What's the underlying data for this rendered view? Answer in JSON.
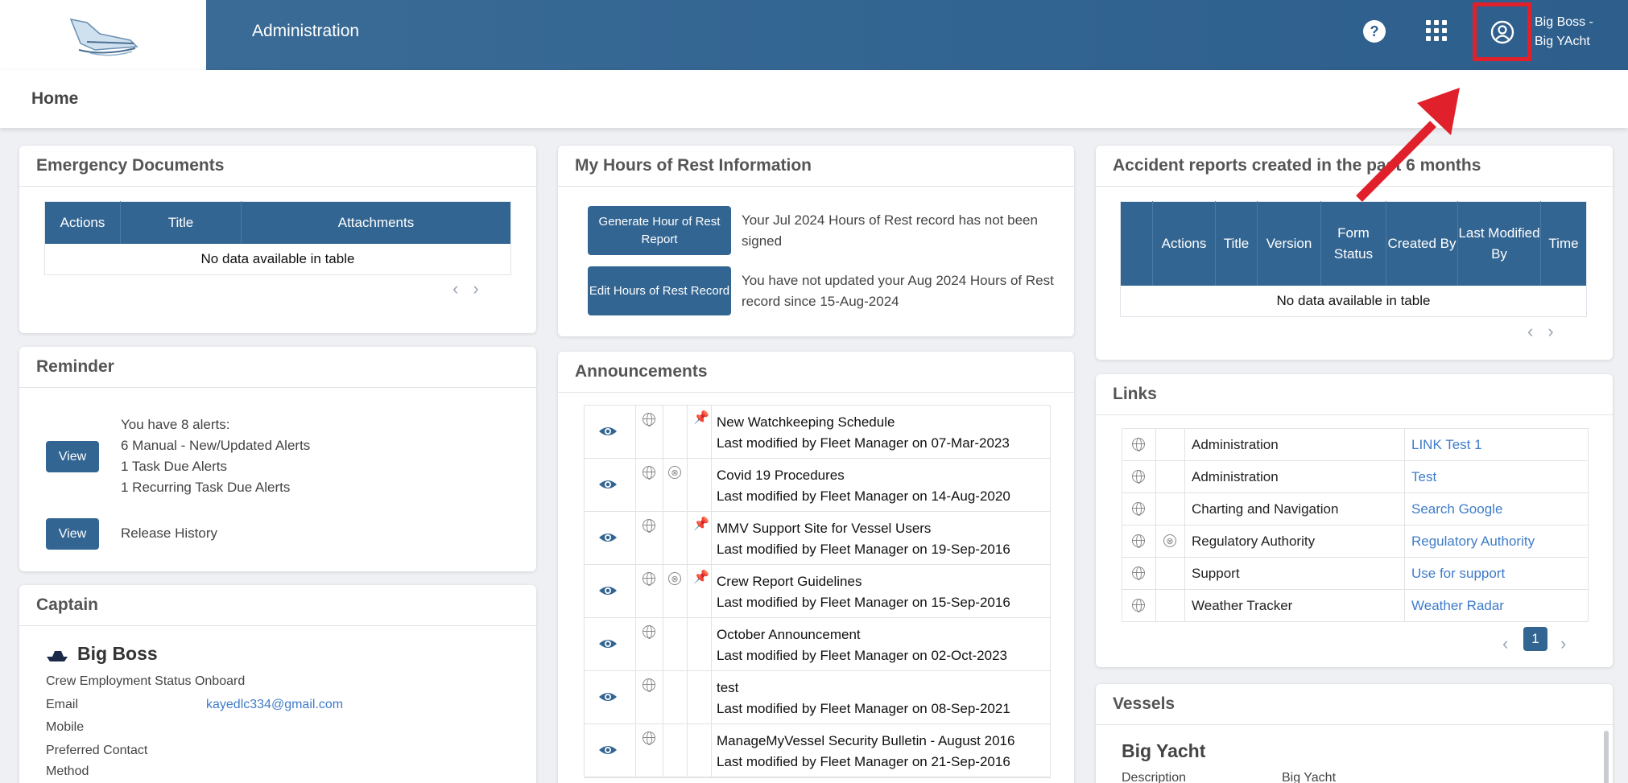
{
  "header": {
    "app_title": "Administration",
    "help_label": "?",
    "user_name_line1": "Big Boss -",
    "user_name_line2": "Big YAcht",
    "highlight_color": "#e0202a",
    "brand_color": "#336592"
  },
  "breadcrumb": {
    "current": "Home"
  },
  "emergency_documents": {
    "title": "Emergency Documents",
    "columns": [
      "Actions",
      "Title",
      "Attachments"
    ],
    "empty_text": "No data available in table",
    "pager": [
      "‹",
      "›"
    ]
  },
  "hours_of_rest": {
    "title": "My Hours of Rest Information",
    "generate_button": "Generate Hour of Rest Report",
    "generate_message": "Your Jul 2024 Hours of Rest record has not been signed",
    "edit_button": "Edit Hours of Rest Record",
    "edit_message": "You have not updated your Aug 2024 Hours of Rest record since 15-Aug-2024"
  },
  "accident_reports": {
    "title": "Accident reports created in the past 6 months",
    "columns": [
      "",
      "Actions",
      "Title",
      "Version",
      "Form Status",
      "Created By",
      "Last Modified By",
      "Time"
    ],
    "empty_text": "No data available in table",
    "pager": [
      "‹",
      "›"
    ]
  },
  "reminder": {
    "title": "Reminder",
    "view_label": "View",
    "alerts_lines": [
      "You have 8 alerts:",
      "6 Manual - New/Updated Alerts",
      "1 Task Due Alerts",
      "1 Recurring Task Due Alerts"
    ],
    "release_view_label": "View",
    "release_text": "Release History"
  },
  "announcements": {
    "title": "Announcements",
    "items": [
      {
        "title": "New Watchkeeping Schedule",
        "modified": "Last modified by Fleet Manager on 07-Mar-2023",
        "reg": false,
        "pin": true
      },
      {
        "title": "Covid 19 Procedures",
        "modified": "Last modified by Fleet Manager on 14-Aug-2020",
        "reg": true,
        "pin": false
      },
      {
        "title": "MMV Support Site for Vessel Users",
        "modified": "Last modified by Fleet Manager on 19-Sep-2016",
        "reg": false,
        "pin": true
      },
      {
        "title": "Crew Report Guidelines",
        "modified": "Last modified by Fleet Manager on 15-Sep-2016",
        "reg": true,
        "pin": true
      },
      {
        "title": "October Announcement",
        "modified": "Last modified by Fleet Manager on 02-Oct-2023",
        "reg": false,
        "pin": false
      },
      {
        "title": "test",
        "modified": "Last modified by Fleet Manager on 08-Sep-2021",
        "reg": false,
        "pin": false
      },
      {
        "title": "ManageMyVessel Security Bulletin - August 2016",
        "modified": "Last modified by Fleet Manager on 21-Sep-2016",
        "reg": false,
        "pin": false
      }
    ]
  },
  "links": {
    "title": "Links",
    "rows": [
      {
        "category": "Administration",
        "link": "LINK Test 1",
        "reg": false
      },
      {
        "category": "Administration",
        "link": "Test",
        "reg": false
      },
      {
        "category": "Charting and Navigation",
        "link": "Search Google",
        "reg": false
      },
      {
        "category": "Regulatory Authority",
        "link": "Regulatory Authority",
        "reg": true
      },
      {
        "category": "Support",
        "link": "Use for support",
        "reg": false
      },
      {
        "category": "Weather Tracker",
        "link": "Weather Radar",
        "reg": false
      }
    ],
    "prev": "‹",
    "page": "1",
    "next": "›"
  },
  "captain": {
    "title": "Captain",
    "name": "Big Boss",
    "status": "Crew Employment Status Onboard",
    "email_label": "Email",
    "email_value": "kayedlc334@gmail.com",
    "mobile_label": "Mobile",
    "contact_label_1": "Preferred Contact",
    "contact_label_2": "Method"
  },
  "vessels": {
    "title": "Vessels",
    "vessel_name": "Big Yacht",
    "description_label": "Description",
    "description_value": "Big Yacht"
  }
}
